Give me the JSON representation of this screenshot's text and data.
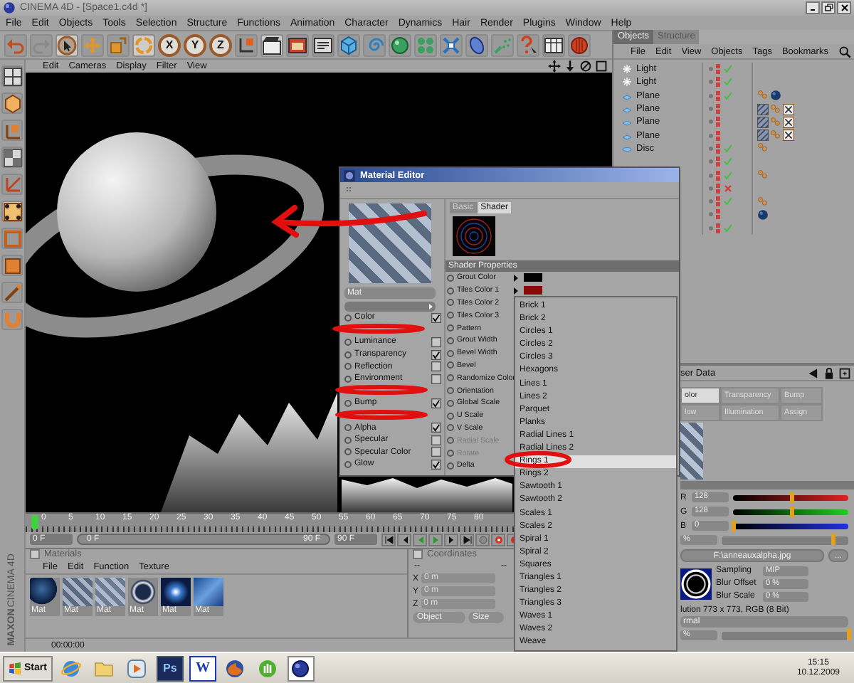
{
  "window": {
    "title": "CINEMA 4D - [Space1.c4d *]"
  },
  "menu": [
    "File",
    "Edit",
    "Objects",
    "Tools",
    "Selection",
    "Structure",
    "Functions",
    "Animation",
    "Character",
    "Dynamics",
    "Hair",
    "Render",
    "Plugins",
    "Window",
    "Help"
  ],
  "toolbar": [
    {
      "kind": "undo",
      "active": false
    },
    {
      "kind": "redo",
      "active": false
    },
    {
      "kind": "select",
      "active": true
    },
    {
      "kind": "move",
      "active": false
    },
    {
      "kind": "scale",
      "active": false
    },
    {
      "kind": "rotate",
      "active": true
    },
    {
      "kind": "axis",
      "label": "X",
      "active": true
    },
    {
      "kind": "axis",
      "label": "Y",
      "active": true
    },
    {
      "kind": "axis",
      "label": "Z",
      "active": true
    },
    {
      "kind": "coords",
      "active": false
    },
    {
      "kind": "render-view",
      "active": true
    },
    {
      "kind": "render-picture",
      "active": false
    },
    {
      "kind": "render-settings",
      "active": false
    },
    {
      "kind": "cube",
      "active": false
    },
    {
      "kind": "spline",
      "active": false
    },
    {
      "kind": "nurbs",
      "active": false
    },
    {
      "kind": "array",
      "active": false
    },
    {
      "kind": "deformer",
      "active": false
    },
    {
      "kind": "environment",
      "active": false
    },
    {
      "kind": "particles",
      "active": false
    },
    {
      "kind": "help",
      "active": false
    },
    {
      "kind": "table",
      "active": false
    },
    {
      "kind": "record",
      "active": false
    }
  ],
  "left_toolbar": [
    {
      "kind": "viewport",
      "active": false
    },
    {
      "kind": "model",
      "active": false
    },
    {
      "kind": "object",
      "active": false
    },
    {
      "kind": "texture",
      "active": false
    },
    {
      "kind": "axis-mode",
      "active": false
    },
    {
      "kind": "points",
      "active": true
    },
    {
      "kind": "edges",
      "active": false
    },
    {
      "kind": "polygons",
      "active": false
    },
    {
      "kind": "tweak",
      "active": false
    },
    {
      "kind": "magnet",
      "active": false
    }
  ],
  "logo": {
    "brand": "MAXON",
    "product": "CINEMA 4D"
  },
  "viewport": {
    "menu": [
      "Edit",
      "Cameras",
      "Display",
      "Filter",
      "View"
    ]
  },
  "timeline": {
    "ticks": [
      "0",
      "5",
      "10",
      "15",
      "20",
      "25",
      "30",
      "35",
      "40",
      "45",
      "50",
      "55",
      "60",
      "65",
      "70",
      "75",
      "80"
    ],
    "level": 0,
    "start": "0 F",
    "range": {
      "start": "0 F",
      "end": "90 F",
      "level": 1
    },
    "end": "90 F"
  },
  "materials": {
    "title": "Materials",
    "menu": [
      "File",
      "Edit",
      "Function",
      "Texture"
    ],
    "items": [
      {
        "name": "Mat",
        "kind": "planet"
      },
      {
        "name": "Mat",
        "kind": "stripes-logo"
      },
      {
        "name": "Mat",
        "kind": "stripes"
      },
      {
        "name": "Mat",
        "kind": "rings"
      },
      {
        "name": "Mat",
        "kind": "nebula"
      },
      {
        "name": "Mat",
        "kind": "water"
      }
    ],
    "time": "00:00:00"
  },
  "coordinates": {
    "title": "Coordinates",
    "header": [
      "--",
      "--"
    ],
    "rows": [
      {
        "axis": "X",
        "value": "0 m"
      },
      {
        "axis": "Y",
        "value": "0 m"
      },
      {
        "axis": "Z",
        "value": "0 m"
      }
    ],
    "mode": "Object",
    "size": "Size"
  },
  "objects": {
    "tabs": [
      {
        "label": "Objects",
        "selected": true
      },
      {
        "label": "Structure",
        "selected": false
      }
    ],
    "menu": [
      "File",
      "Edit",
      "View",
      "Objects",
      "Tags",
      "Bookmarks"
    ],
    "rows": [
      {
        "name": "Light",
        "kind": "light",
        "enabled": true,
        "tags": []
      },
      {
        "name": "Light",
        "kind": "light",
        "enabled": true,
        "tags": []
      },
      {
        "name": "Plane",
        "kind": "plane",
        "enabled": true,
        "tags": [
          {
            "kind": "texture"
          },
          {
            "kind": "material-sphere"
          }
        ]
      },
      {
        "name": "Plane",
        "kind": "plane",
        "tags": [
          {
            "kind": "material-stripes"
          },
          {
            "kind": "texture"
          },
          {
            "kind": "uvw"
          }
        ]
      },
      {
        "name": "Plane",
        "kind": "plane",
        "tags": [
          {
            "kind": "material-stripes"
          },
          {
            "kind": "texture"
          },
          {
            "kind": "uvw"
          }
        ]
      },
      {
        "name": "Plane",
        "kind": "plane",
        "tags": [
          {
            "kind": "material-stripes"
          },
          {
            "kind": "texture"
          },
          {
            "kind": "uvw"
          }
        ]
      },
      {
        "name": "Disc",
        "kind": "disc",
        "enabled": true,
        "tags": [
          {
            "kind": "texture"
          }
        ]
      },
      {
        "enabled": true,
        "tags": []
      },
      {
        "enabled": true,
        "tags": [
          {
            "kind": "texture"
          }
        ]
      },
      {
        "enabled": false,
        "tags": []
      },
      {
        "enabled": true,
        "tags": [
          {
            "kind": "texture"
          }
        ]
      },
      {
        "tags": [
          {
            "kind": "material-sphere"
          }
        ]
      },
      {
        "enabled": true,
        "tags": []
      }
    ]
  },
  "attributes": {
    "title": "ser Data",
    "tabs": [
      {
        "label": "olor",
        "selected": true
      },
      {
        "label": "Transparency",
        "selected": false
      },
      {
        "label": "Bump",
        "selected": false
      },
      {
        "label": "low",
        "selected": false
      },
      {
        "label": "Illumination",
        "selected": false
      },
      {
        "label": "Assign",
        "selected": false
      }
    ],
    "rgb": [
      {
        "label": "R",
        "value": "128",
        "level": 0.5
      },
      {
        "label": "G",
        "value": "128",
        "level": 0.5
      },
      {
        "label": "B",
        "value": "0",
        "level": 0
      }
    ],
    "brightness": {
      "value": "%",
      "level": 0.88
    },
    "file": "F:\\anneauxalpha.jpg",
    "browse": "...",
    "sampling": {
      "label": "Sampling",
      "value": "MIP"
    },
    "blur_offset": {
      "label": "Blur Offset",
      "value": "0 %"
    },
    "blur_scale": {
      "label": "Blur Scale",
      "value": "0 %"
    },
    "resolution": "lution 773 x 773, RGB (8 Bit)",
    "mix_mode": "rmal",
    "mix_strength": {
      "value": "%",
      "level": 1
    }
  },
  "material_editor": {
    "title": "Material Editor",
    "name": "Mat",
    "channels": [
      {
        "label": "Color",
        "checked": true
      },
      {
        "label": "Luminance",
        "checked": false
      },
      {
        "label": "Transparency",
        "checked": true
      },
      {
        "label": "Reflection",
        "checked": false
      },
      {
        "label": "Environment",
        "checked": false
      },
      {
        "label": "Bump",
        "checked": true
      },
      {
        "label": "Alpha",
        "checked": true
      },
      {
        "label": "Specular",
        "checked": false
      },
      {
        "label": "Specular Color",
        "checked": false
      },
      {
        "label": "Glow",
        "checked": true
      }
    ],
    "tabs": [
      {
        "label": "Basic",
        "selected": false
      },
      {
        "label": "Shader",
        "selected": true
      }
    ],
    "section": "Shader Properties",
    "params": [
      {
        "label": "Grout Color",
        "kind": "color",
        "color": "#000000",
        "disabled": false
      },
      {
        "label": "Tiles Color 1",
        "kind": "color",
        "color": "#8a0a0a",
        "disabled": false
      },
      {
        "label": "Tiles Color 2",
        "kind": "color",
        "disabled": false
      },
      {
        "label": "Tiles Color 3",
        "kind": "color",
        "disabled": false
      },
      {
        "label": "Pattern",
        "kind": "value",
        "disabled": false
      },
      {
        "label": "Grout Width",
        "kind": "value",
        "disabled": false
      },
      {
        "label": "Bevel Width",
        "kind": "value",
        "disabled": false
      },
      {
        "label": "Bevel",
        "kind": "value",
        "disabled": false
      },
      {
        "label": "Randomize Color",
        "kind": "value",
        "disabled": false
      },
      {
        "label": "Orientation",
        "kind": "value",
        "disabled": false
      },
      {
        "label": "Global Scale",
        "kind": "value",
        "disabled": false
      },
      {
        "label": "U Scale",
        "kind": "value",
        "disabled": false
      },
      {
        "label": "V Scale",
        "kind": "value",
        "disabled": false
      },
      {
        "label": "Radial Scale",
        "kind": "value",
        "disabled": true
      },
      {
        "label": "Rotate",
        "kind": "value",
        "disabled": true
      },
      {
        "label": "Delta",
        "kind": "value",
        "disabled": false
      }
    ]
  },
  "dropdown": {
    "items": [
      {
        "label": "Brick 1",
        "selected": false
      },
      {
        "label": "Brick 2",
        "selected": false
      },
      {
        "label": "Circles 1",
        "selected": false
      },
      {
        "label": "Circles 2",
        "selected": false
      },
      {
        "label": "Circles 3",
        "selected": false
      },
      {
        "label": "Hexagons",
        "selected": false
      },
      {
        "label": "Lines 1",
        "selected": false
      },
      {
        "label": "Lines 2",
        "selected": false
      },
      {
        "label": "Parquet",
        "selected": false
      },
      {
        "label": "Planks",
        "selected": false
      },
      {
        "label": "Radial Lines 1",
        "selected": false
      },
      {
        "label": "Radial Lines 2",
        "selected": false
      },
      {
        "label": "Rings 1",
        "selected": true
      },
      {
        "label": "Rings 2",
        "selected": false
      },
      {
        "label": "Sawtooth 1",
        "selected": false
      },
      {
        "label": "Sawtooth 2",
        "selected": false
      },
      {
        "label": "Scales 1",
        "selected": false
      },
      {
        "label": "Scales 2",
        "selected": false
      },
      {
        "label": "Spiral 1",
        "selected": false
      },
      {
        "label": "Spiral 2",
        "selected": false
      },
      {
        "label": "Squares",
        "selected": false
      },
      {
        "label": "Triangles 1",
        "selected": false
      },
      {
        "label": "Triangles 2",
        "selected": false
      },
      {
        "label": "Triangles 3",
        "selected": false
      },
      {
        "label": "Waves 1",
        "selected": false
      },
      {
        "label": "Waves 2",
        "selected": false
      },
      {
        "label": "Weave",
        "selected": false
      }
    ]
  },
  "taskbar": {
    "start": "Start",
    "apps": [
      {
        "kind": "browser",
        "active": false
      },
      {
        "kind": "folder",
        "active": false
      },
      {
        "kind": "media",
        "active": false
      },
      {
        "kind": "photoshop",
        "label": "Ps",
        "active": false
      },
      {
        "kind": "word",
        "label": "W",
        "active": false
      },
      {
        "kind": "firefox",
        "active": false
      },
      {
        "kind": "green",
        "active": false
      },
      {
        "kind": "cinema",
        "active": true
      }
    ],
    "clock": {
      "time": "15:15",
      "date": "10.12.2009"
    }
  }
}
